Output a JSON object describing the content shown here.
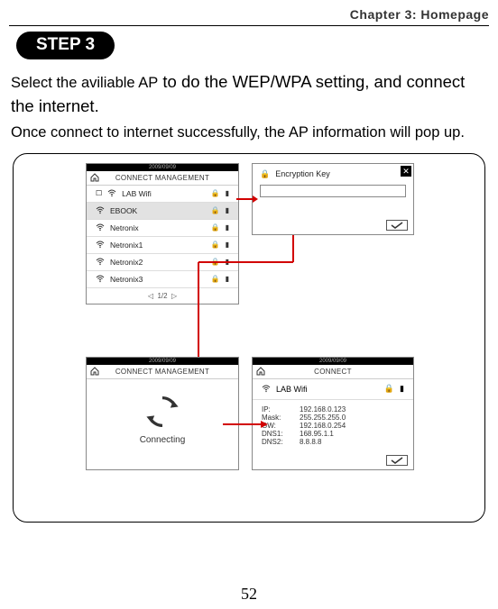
{
  "header": {
    "chapter": "Chapter 3: Homepage"
  },
  "step": {
    "label": "STEP 3"
  },
  "paragraphs": {
    "p1a": "Select the aviliable AP",
    "p1b": " to do the WEP/WPA setting, and connect the internet.",
    "p2": "Once connect to internet successfully, the AP information will pop up."
  },
  "screenshots": {
    "date": "2009/09/09",
    "connMgmt": "CONNECT MANAGEMENT",
    "connMgmtShort": "CONNECT MANAGEMENT",
    "connect": "CONNECT",
    "wifiRows": [
      {
        "name": "LAB Wifi",
        "selected": false
      },
      {
        "name": "EBOOK",
        "selected": true
      },
      {
        "name": "Netronix",
        "selected": false
      },
      {
        "name": "Netronix1",
        "selected": false
      },
      {
        "name": "Netronix2",
        "selected": false
      },
      {
        "name": "Netronix3",
        "selected": false
      }
    ],
    "pager": "1/2",
    "encDialog": {
      "title": "Encryption Key"
    },
    "connecting": "Connecting",
    "result": {
      "ssid": "LAB Wifi",
      "ip": {
        "k": "IP:",
        "v": "192.168.0.123"
      },
      "mask": {
        "k": "Mask:",
        "v": "255.255.255.0"
      },
      "gw": {
        "k": "GW:",
        "v": "192.168.0.254"
      },
      "dns1": {
        "k": "DNS1:",
        "v": "168.95.1.1"
      },
      "dns2": {
        "k": "DNS2:",
        "v": "8.8.8.8"
      }
    }
  },
  "pageNumber": "52"
}
